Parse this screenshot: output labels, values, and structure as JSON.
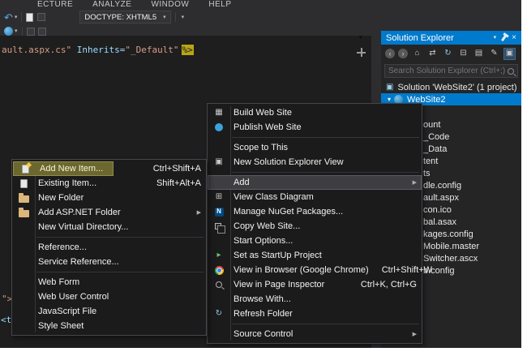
{
  "colors": {
    "accent": "#007acc",
    "selection": "#007acc",
    "marker_highlight": "#6b672f"
  },
  "menubar": {
    "items": [
      "ECTURE",
      "ANALYZE",
      "WINDOW",
      "HELP"
    ]
  },
  "toolbar": {
    "doctype_combo": "DOCTYPE: XHTML5"
  },
  "editor": {
    "code_segment_1": "ault.aspx.cs\"",
    "code_segment_2": " Inherits=",
    "code_segment_3": "\"_Default\"",
    "code_segment_4": "%>",
    "fragment_1": "\">",
    "fragment_2": "<ta"
  },
  "solution_explorer": {
    "title": "Solution Explorer",
    "search_placeholder": "Search Solution Explorer (Ctrl+;)",
    "tree": [
      {
        "label": "Solution 'WebSite2' (1 project)"
      },
      {
        "label": "WebSite2",
        "selected": true
      },
      {
        "label": "ount"
      },
      {
        "label": "_Code"
      },
      {
        "label": "_Data"
      },
      {
        "label": "tent"
      },
      {
        "label": "ts"
      },
      {
        "label": "dle.config"
      },
      {
        "label": "ault.aspx"
      },
      {
        "label": "con.ico"
      },
      {
        "label": "bal.asax"
      },
      {
        "label": "kages.config"
      },
      {
        "label": "Mobile.master"
      },
      {
        "label": "Switcher.ascx"
      },
      {
        "label": "b.config"
      }
    ]
  },
  "context_menu": {
    "items": [
      {
        "label": "Build Web Site"
      },
      {
        "label": "Publish Web Site"
      },
      {
        "label": "Scope to This"
      },
      {
        "label": "New Solution Explorer View"
      },
      {
        "label": "Add",
        "has_submenu": true,
        "highlighted": true
      },
      {
        "label": "View Class Diagram"
      },
      {
        "label": "Manage NuGet Packages..."
      },
      {
        "label": "Copy Web Site..."
      },
      {
        "label": "Start Options..."
      },
      {
        "label": "Set as StartUp Project"
      },
      {
        "label": "View in Browser (Google Chrome)",
        "shortcut": "Ctrl+Shift+W"
      },
      {
        "label": "View in Page Inspector",
        "shortcut": "Ctrl+K, Ctrl+G"
      },
      {
        "label": "Browse With..."
      },
      {
        "label": "Refresh Folder"
      },
      {
        "label": "Source Control",
        "has_submenu": true
      }
    ]
  },
  "submenu": {
    "items": [
      {
        "label": "Add New Item...",
        "shortcut": "Ctrl+Shift+A",
        "highlighted": true
      },
      {
        "label": "Existing Item...",
        "shortcut": "Shift+Alt+A"
      },
      {
        "label": "New Folder"
      },
      {
        "label": "Add ASP.NET Folder",
        "has_submenu": true
      },
      {
        "label": "New Virtual Directory..."
      },
      {
        "label": "Reference..."
      },
      {
        "label": "Service Reference..."
      },
      {
        "label": "Web Form"
      },
      {
        "label": "Web User Control"
      },
      {
        "label": "JavaScript File"
      },
      {
        "label": "Style Sheet"
      }
    ]
  },
  "icons": {
    "back_nav": "↶",
    "dropdown": "▾",
    "nav_triangle": "▼",
    "build": "▦",
    "new_view": "▣",
    "class_diagram": "⊞",
    "refresh": "↻",
    "submenu_arrow": "▶",
    "home": "⌂",
    "sync": "⇄",
    "collapse_all": "⊟",
    "show_all": "▤",
    "pencil": "✎",
    "preview": "▣",
    "back": "‹",
    "forward": "›",
    "nuget": "N",
    "startup": "▸",
    "solution": "▣",
    "expander_open": "▾",
    "close": "×"
  }
}
